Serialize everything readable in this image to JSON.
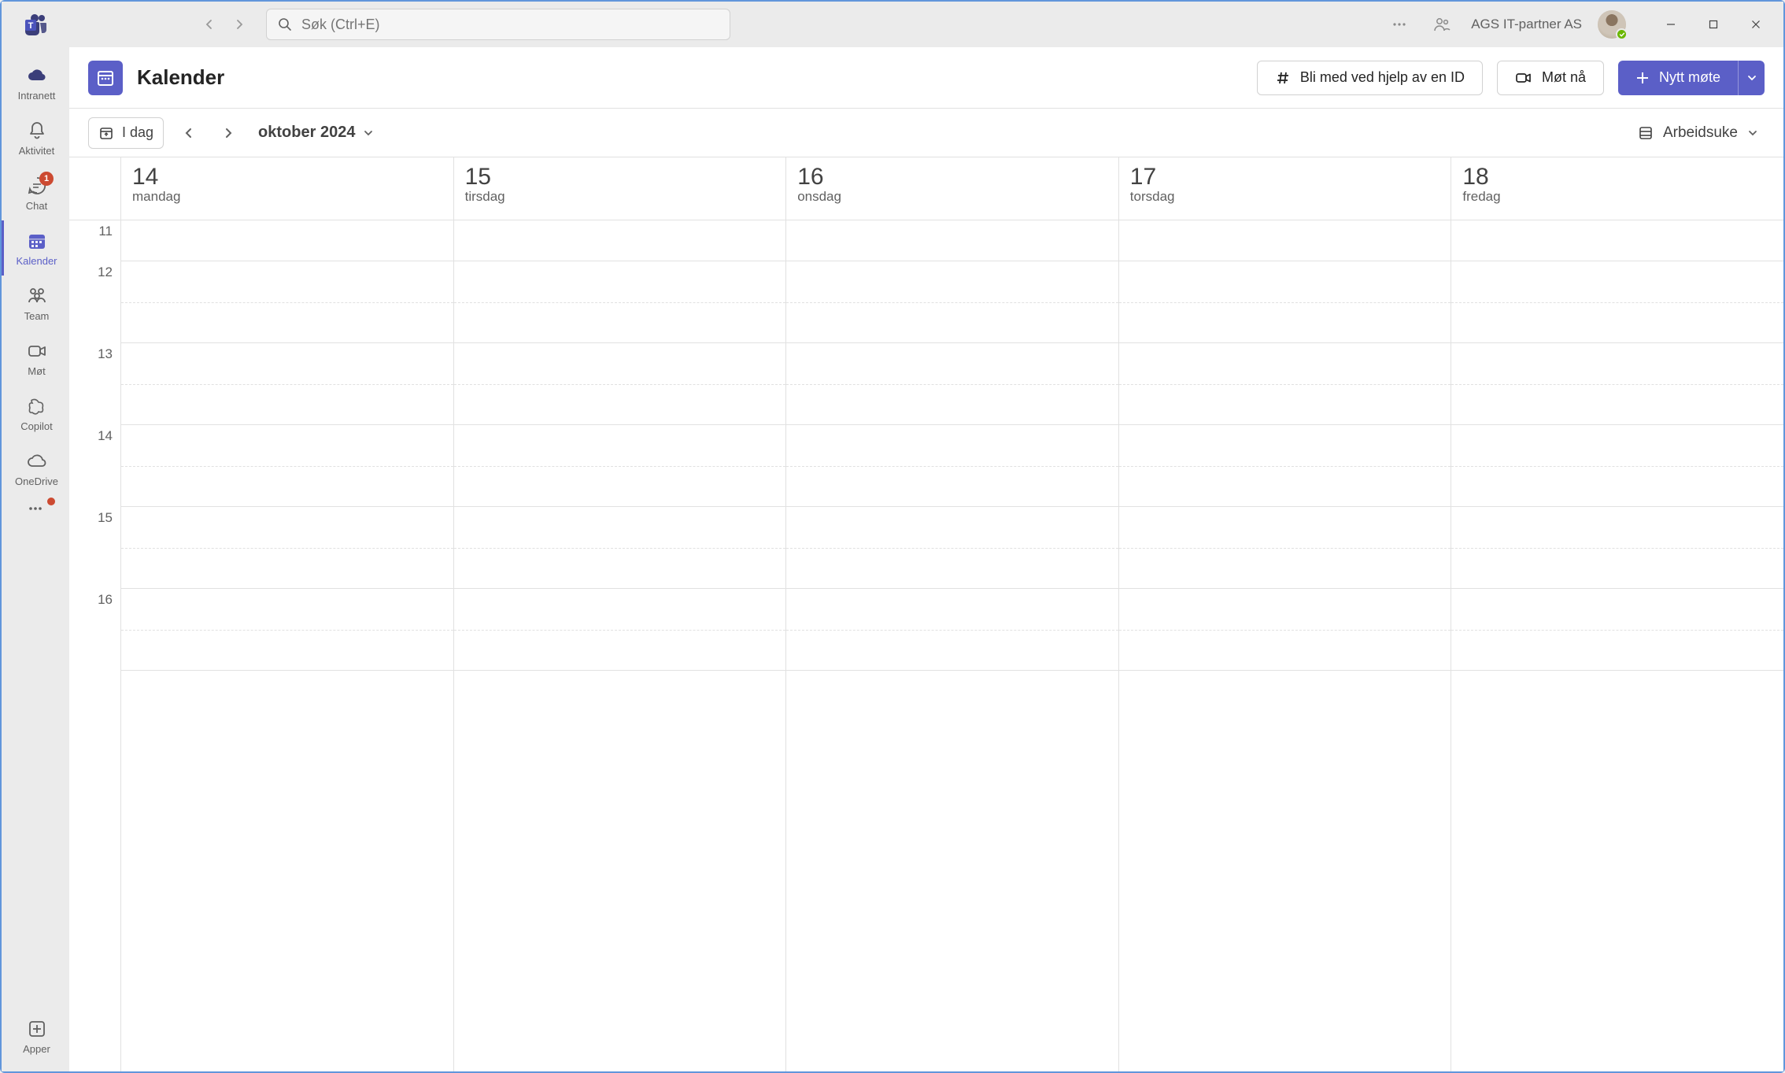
{
  "titlebar": {
    "search_placeholder": "Søk (Ctrl+E)",
    "org": "AGS IT-partner AS"
  },
  "sidebar": {
    "items": [
      {
        "label": "Intranett",
        "icon": "cloud-filled"
      },
      {
        "label": "Aktivitet",
        "icon": "bell"
      },
      {
        "label": "Chat",
        "icon": "chat",
        "badge": "1"
      },
      {
        "label": "Kalender",
        "icon": "calendar",
        "active": true
      },
      {
        "label": "Team",
        "icon": "people"
      },
      {
        "label": "Møt",
        "icon": "video"
      },
      {
        "label": "Copilot",
        "icon": "copilot"
      },
      {
        "label": "OneDrive",
        "icon": "cloud-outline"
      }
    ],
    "apps_label": "Apper"
  },
  "header": {
    "title": "Kalender",
    "join_id": "Bli med ved hjelp av en ID",
    "meet_now": "Møt nå",
    "new_meeting": "Nytt møte"
  },
  "toolbar": {
    "today": "I dag",
    "month": "oktober 2024",
    "view": "Arbeidsuke"
  },
  "calendar": {
    "hours": [
      "11",
      "12",
      "13",
      "14",
      "15",
      "16"
    ],
    "days": [
      {
        "num": "14",
        "name": "mandag"
      },
      {
        "num": "15",
        "name": "tirsdag"
      },
      {
        "num": "16",
        "name": "onsdag"
      },
      {
        "num": "17",
        "name": "torsdag"
      },
      {
        "num": "18",
        "name": "fredag"
      }
    ]
  }
}
